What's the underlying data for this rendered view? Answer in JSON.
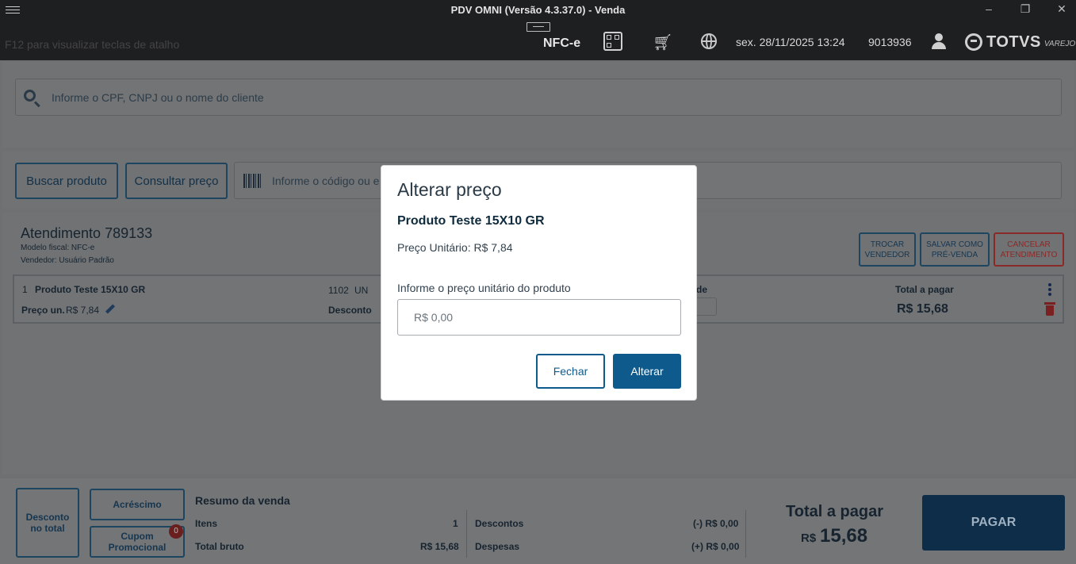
{
  "window": {
    "title": "PDV OMNI (Versão 4.3.37.0) - Venda",
    "minimize": "–",
    "restore": "❐",
    "close": "✕"
  },
  "topbar": {
    "hint": "F12 para visualizar teclas de atalho",
    "doc_type": "NFC-e",
    "datetime": "sex. 28/11/2025 13:24",
    "operator_id": "9013936",
    "brand_name": "TOTVS",
    "brand_sub": "VAREJO",
    "icons": [
      "menu-icon",
      "qr-code-icon",
      "cart-icon",
      "globe-icon",
      "user-icon"
    ]
  },
  "client": {
    "search_placeholder": "Informe o CPF, CNPJ ou o nome do cliente"
  },
  "product": {
    "search_button": "Buscar produto",
    "price_check_button": "Consultar preço",
    "code_placeholder": "Informe o código ou e"
  },
  "attendance": {
    "title": "Atendimento 789133",
    "fiscal_model": "Modelo fiscal: NFC-e",
    "seller": "Vendedor: Usuário Padrão",
    "actions": {
      "change_seller": [
        "TROCAR",
        "VENDEDOR"
      ],
      "save_presale": [
        "SALVAR COMO",
        "PRÉ-VENDA"
      ],
      "cancel": [
        "CANCELAR",
        "ATENDIMENTO"
      ]
    }
  },
  "item": {
    "index": "1",
    "name": "Produto Teste 15X10 GR",
    "code": "1102",
    "unit": "UN",
    "unit_price_label": "Preço un.",
    "unit_price": "R$ 7,84",
    "discount_label": "Desconto",
    "qty_label_partial": "de",
    "total_label": "Total a pagar",
    "total": "R$ 15,68"
  },
  "footer": {
    "discount_total": [
      "Desconto",
      "no total"
    ],
    "surcharge": "Acréscimo",
    "coupon": "Cupom Promocional",
    "coupon_count": "0",
    "summary_title": "Resumo da venda",
    "items_label": "Itens",
    "items_value": "1",
    "gross_label": "Total bruto",
    "gross_value": "R$ 15,68",
    "discounts_label": "Descontos",
    "discounts_value": "(-) R$ 0,00",
    "expenses_label": "Despesas",
    "expenses_value": "(+) R$ 0,00",
    "total_label": "Total a pagar",
    "total_currency": "R$",
    "total_value": "15,68",
    "pay_button": "PAGAR"
  },
  "modal": {
    "title": "Alterar preço",
    "product": "Produto Teste 15X10 GR",
    "unit_price": "Preço Unitário: R$ 7,84",
    "input_label": "Informe o preço unitário do produto",
    "input_placeholder": "R$ 0,00",
    "input_value": "",
    "close_button": "Fechar",
    "confirm_button": "Alterar"
  }
}
